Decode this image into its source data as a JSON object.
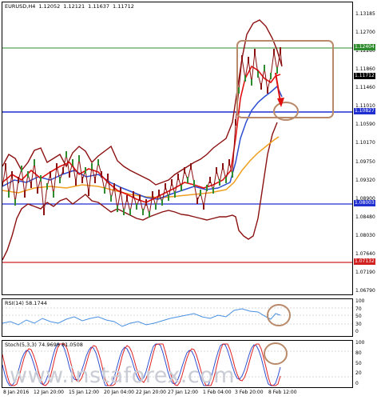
{
  "main_chart": {
    "symbol": "EURUSD,H4",
    "open": "1.12052",
    "high": "1.12121",
    "low": "1.11637",
    "close": "1.11712",
    "price_axis": [
      "1.13185",
      "1.12700",
      "1.12280",
      "1.11860",
      "1.11460",
      "1.11010",
      "1.10590",
      "1.10170",
      "1.09750",
      "1.09320",
      "1.08900",
      "1.08480",
      "1.08030",
      "1.07640",
      "1.07190",
      "1.06790"
    ],
    "tags": [
      {
        "label": "1.12404",
        "color": "#2e8b2e"
      },
      {
        "label": "1.11712",
        "color": "#000000"
      },
      {
        "label": "1.10827",
        "color": "#1f2fd0"
      },
      {
        "label": "1.08003",
        "color": "#1f2fd0"
      },
      {
        "label": "1.07132",
        "color": "#d02020"
      }
    ],
    "levels": {
      "green": "1.12404",
      "blue_upper": "1.10827",
      "blue_lower": "1.08003",
      "red": "1.07132"
    }
  },
  "rsi_panel": {
    "title": "RSI(14) 58.1744",
    "axis": [
      "100",
      "70",
      "50",
      "30",
      "0"
    ]
  },
  "stoch_panel": {
    "title": "Stoch(5,3,3) 74.9698 81.0508",
    "axis": [
      "100",
      "80",
      "50",
      "20",
      "0"
    ]
  },
  "x_axis": [
    "8 Jan 2016",
    "12 Jan 20:00",
    "15 Jan 12:00",
    "20 Jan 04:00",
    "22 Jan 20:00",
    "27 Jan 12:00",
    "1 Feb 04:00",
    "3 Feb 20:00",
    "8 Feb 12:00"
  ],
  "watermark": "www.instaforex.com",
  "colors": {
    "bollinger": "#8b1010",
    "price": "#8b1010",
    "ma_fast": "#e01010",
    "ma_mid": "#2f4fd0",
    "ma_slow": "#f0a020",
    "rsi": "#4a90e0",
    "stoch_main": "#e02020",
    "stoch_signal": "#2f4fd0",
    "highlight": "#b98a6a"
  }
}
